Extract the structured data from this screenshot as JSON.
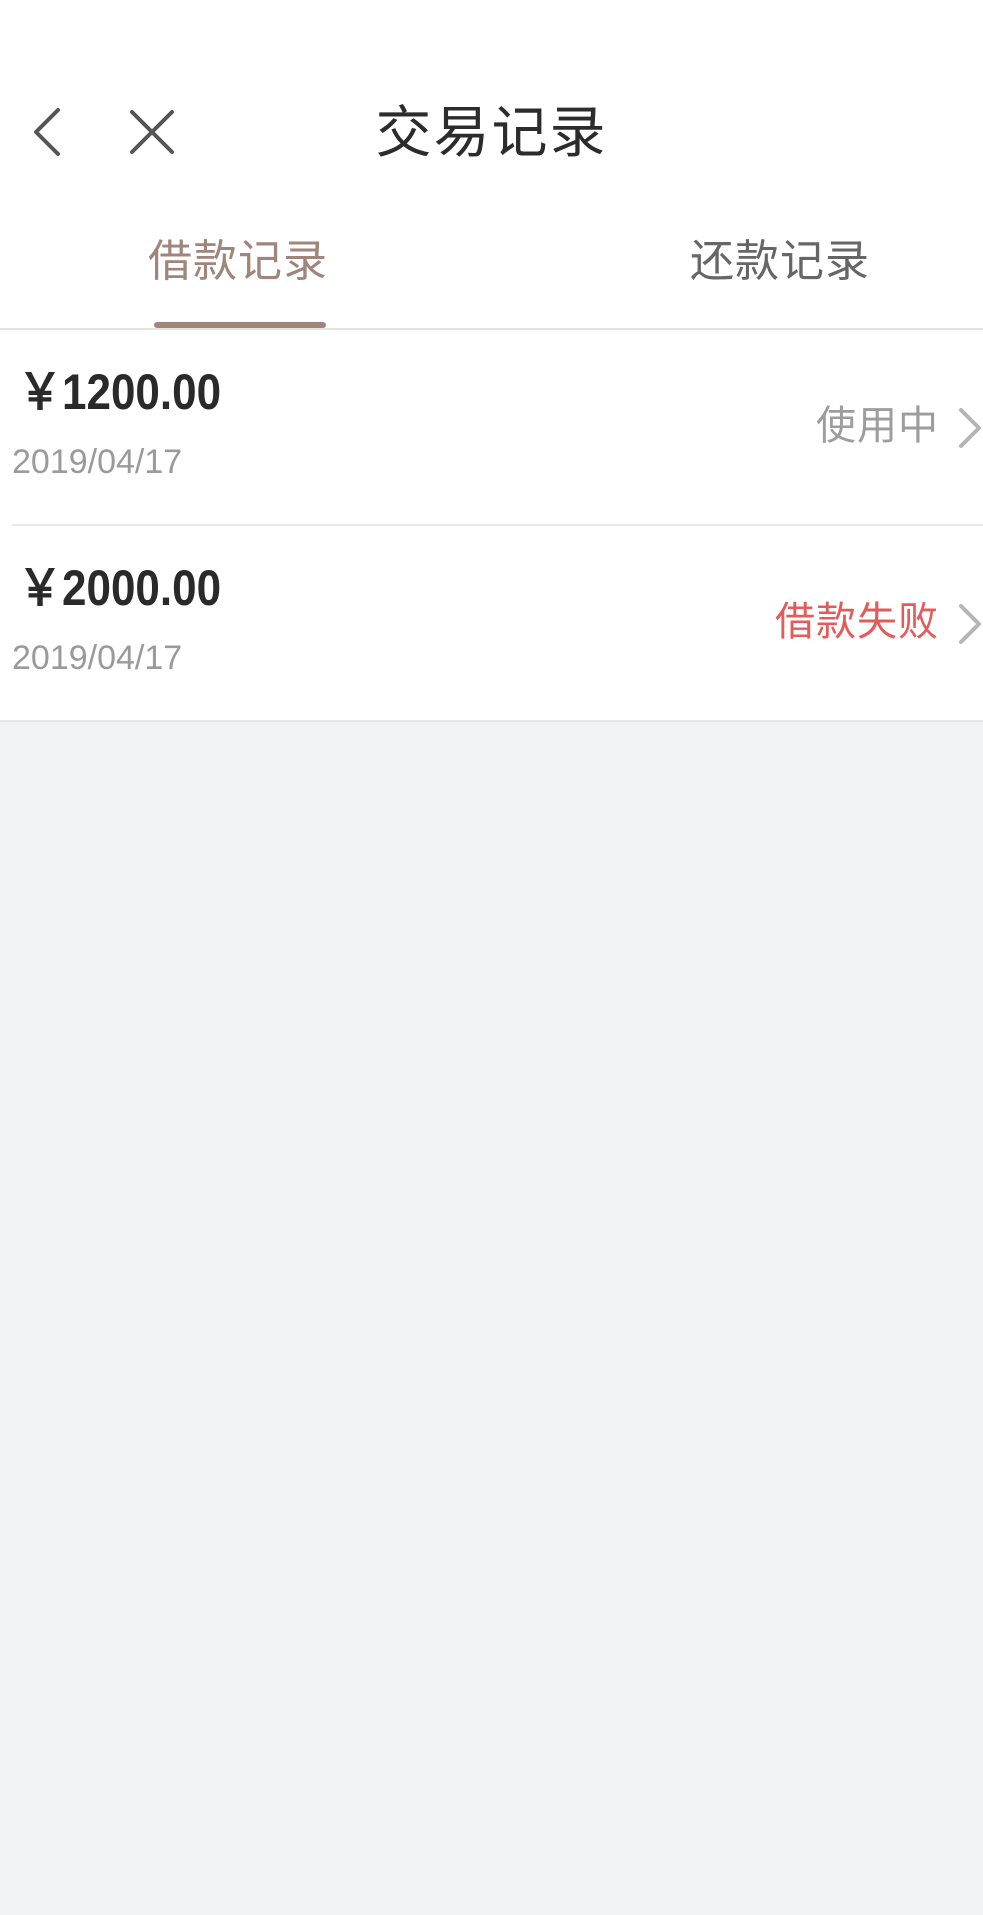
{
  "header": {
    "title": "交易记录",
    "back_icon": "chevron-left-icon",
    "close_icon": "close-icon"
  },
  "tabs": [
    {
      "label": "借款记录",
      "active": true
    },
    {
      "label": "还款记录",
      "active": false
    }
  ],
  "records": [
    {
      "amount": "￥1200.00",
      "date": "2019/04/17",
      "status": "使用中",
      "status_color": "#9d9d9d"
    },
    {
      "amount": "￥2000.00",
      "date": "2019/04/17",
      "status": "借款失败",
      "status_color": "#e35c5c"
    }
  ],
  "colors": {
    "accent": "#a0857b",
    "background": "#f2f3f7",
    "error": "#e35c5c"
  }
}
